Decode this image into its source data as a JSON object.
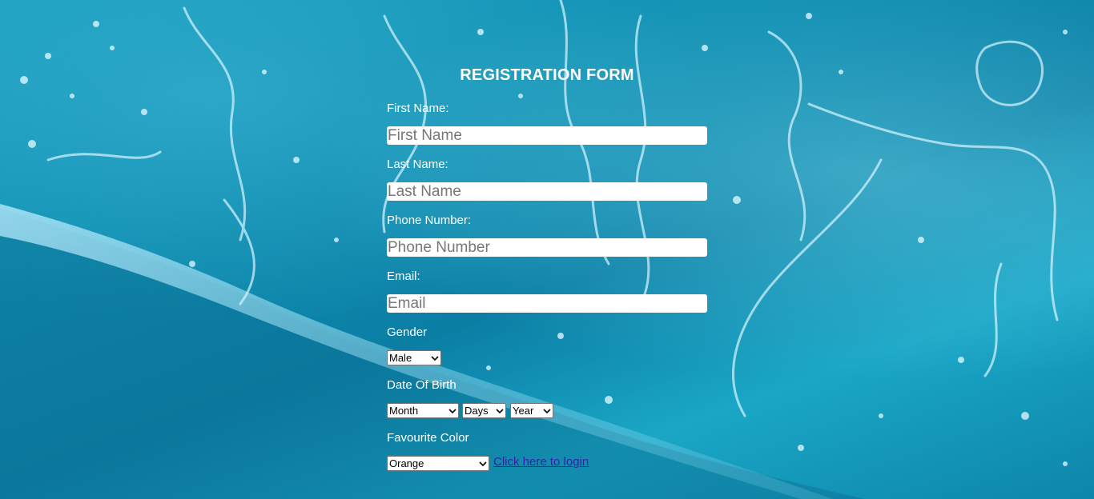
{
  "page": {
    "title": "REGISTRATION FORM"
  },
  "fields": {
    "first_name": {
      "label": "First Name:",
      "placeholder": "First Name"
    },
    "last_name": {
      "label": "Last Name:",
      "placeholder": "Last Name"
    },
    "phone": {
      "label": "Phone Number:",
      "placeholder": "Phone Number"
    },
    "email": {
      "label": "Email:",
      "placeholder": "Email"
    }
  },
  "gender": {
    "label": "Gender",
    "selected": "Male"
  },
  "dob": {
    "label": "Date Of Birth",
    "month": "Month",
    "days": "Days",
    "year": "Year"
  },
  "color": {
    "label": "Favourite Color",
    "selected": "Orange"
  },
  "login": {
    "label": "Click here to login"
  },
  "colors": {
    "background": "#1298bb",
    "text": "#ffffff",
    "link": "#3b1fa8"
  },
  "icons": {
    "select_arrow": "chevron-down-icon"
  }
}
